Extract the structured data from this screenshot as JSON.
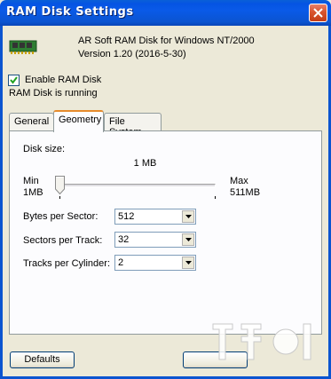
{
  "window": {
    "title": "RAM Disk Settings"
  },
  "header": {
    "app_name": "AR Soft RAM Disk for Windows NT/2000",
    "version": "Version 1.20 (2016-5-30)",
    "icon": "ram-chip-icon"
  },
  "enable": {
    "label": "Enable RAM Disk",
    "checked": true
  },
  "status": "RAM Disk is running",
  "tabs": [
    {
      "label": "General",
      "active": false
    },
    {
      "label": "Geometry",
      "active": true
    },
    {
      "label": "File System",
      "active": false
    }
  ],
  "geometry": {
    "disk_size_label": "Disk size:",
    "disk_size_value": "1 MB",
    "slider": {
      "min_label": "Min",
      "min_value": "1MB",
      "max_label": "Max",
      "max_value": "511MB",
      "position_fraction": 0.0
    },
    "fields": [
      {
        "label": "Bytes per Sector:",
        "value": "512"
      },
      {
        "label": "Sectors per Track:",
        "value": "32"
      },
      {
        "label": "Tracks per Cylinder:",
        "value": "2"
      }
    ]
  },
  "buttons": {
    "defaults": "Defaults"
  },
  "colors": {
    "titlebar": "#0b54d0",
    "close_button": "#d9542e",
    "active_tab_accent": "#e68b2c",
    "dialog_bg": "#ece9d8"
  }
}
